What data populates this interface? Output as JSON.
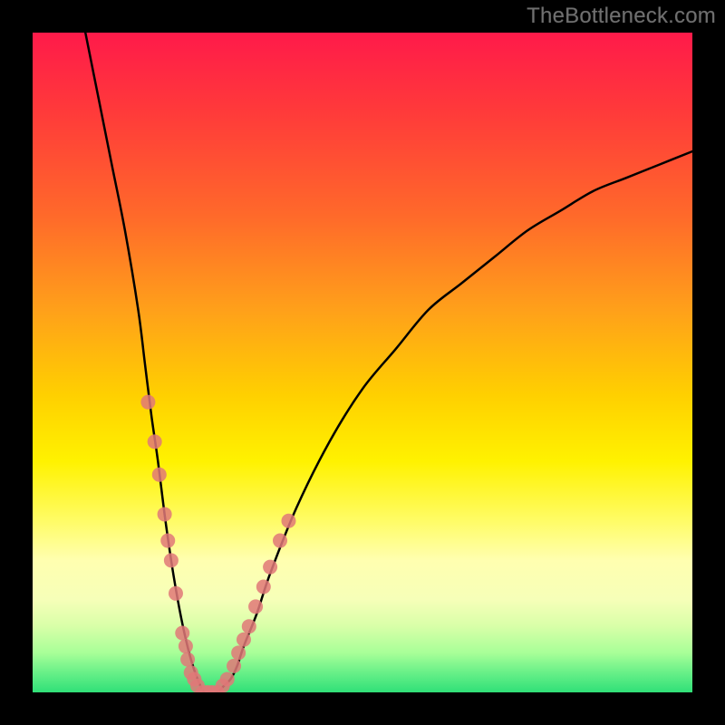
{
  "watermark": "TheBottleneck.com",
  "chart_data": {
    "type": "line",
    "title": "",
    "xlabel": "",
    "ylabel": "",
    "xlim": [
      0,
      100
    ],
    "ylim": [
      0,
      100
    ],
    "grid": false,
    "legend": false,
    "series": [
      {
        "name": "bottleneck-curve",
        "x": [
          8,
          10,
          12,
          14,
          16,
          17,
          18,
          19,
          20,
          21,
          22,
          23,
          24,
          25,
          26,
          27,
          28,
          29,
          30,
          31,
          32,
          34,
          36,
          40,
          45,
          50,
          55,
          60,
          65,
          70,
          75,
          80,
          85,
          90,
          95,
          100
        ],
        "y": [
          100,
          90,
          80,
          70,
          58,
          50,
          42,
          35,
          27,
          20,
          14,
          9,
          5,
          2,
          0,
          0,
          0,
          1,
          2,
          4,
          7,
          12,
          18,
          28,
          38,
          46,
          52,
          58,
          62,
          66,
          70,
          73,
          76,
          78,
          80,
          82
        ]
      },
      {
        "name": "marker-cluster-left",
        "type": "scatter",
        "x": [
          17.5,
          18.5,
          19.2,
          20.0,
          20.5,
          21.0,
          21.7,
          22.7,
          23.2,
          23.5,
          24.0,
          24.5
        ],
        "y": [
          44,
          38,
          33,
          27,
          23,
          20,
          15,
          9,
          7,
          5,
          3,
          2
        ]
      },
      {
        "name": "marker-cluster-bottom",
        "type": "scatter",
        "x": [
          25.0,
          25.8,
          26.5,
          27.2,
          28.0,
          28.8,
          29.5
        ],
        "y": [
          1,
          0,
          0,
          0,
          0,
          1,
          2
        ]
      },
      {
        "name": "marker-cluster-right",
        "type": "scatter",
        "x": [
          30.5,
          31.2,
          32.0,
          32.8,
          33.8,
          35.0,
          36.0,
          37.5,
          38.8
        ],
        "y": [
          4,
          6,
          8,
          10,
          13,
          16,
          19,
          23,
          26
        ]
      }
    ],
    "colors": {
      "curve": "#000000",
      "markers": "#e07878"
    }
  }
}
